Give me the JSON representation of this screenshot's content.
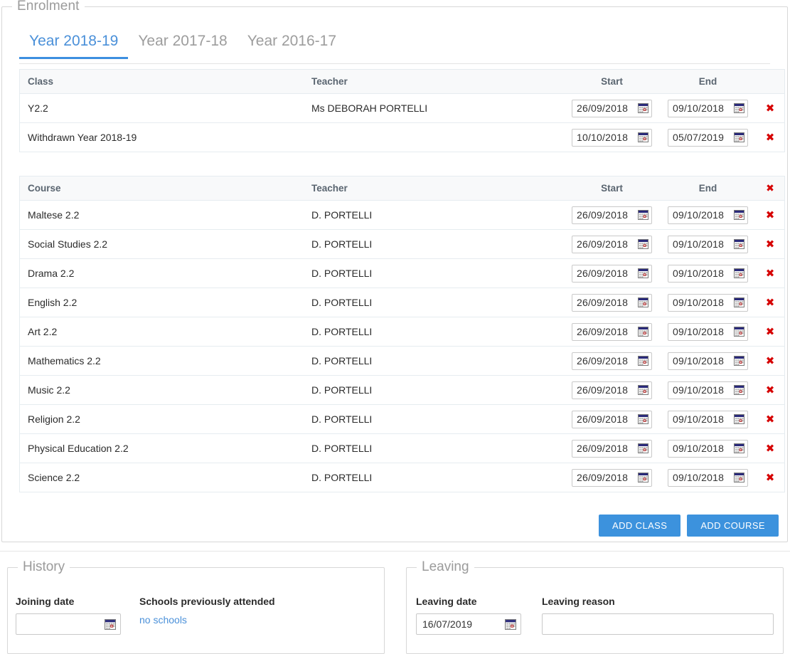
{
  "enrolment": {
    "legend": "Enrolment",
    "tabs": [
      {
        "label": "Year 2018-19",
        "active": true
      },
      {
        "label": "Year 2017-18",
        "active": false
      },
      {
        "label": "Year 2016-17",
        "active": false
      }
    ],
    "class_table": {
      "headers": {
        "name": "Class",
        "teacher": "Teacher",
        "start": "Start",
        "end": "End",
        "delete": ""
      },
      "rows": [
        {
          "name": "Y2.2",
          "teacher": "Ms DEBORAH PORTELLI",
          "start": "26/09/2018",
          "end": "09/10/2018",
          "delete": "✖"
        },
        {
          "name": "Withdrawn Year 2018-19",
          "teacher": "",
          "start": "10/10/2018",
          "end": "05/07/2019",
          "delete": "✖"
        }
      ]
    },
    "course_table": {
      "headers": {
        "name": "Course",
        "teacher": "Teacher",
        "start": "Start",
        "end": "End",
        "delete": "✖"
      },
      "rows": [
        {
          "name": "Maltese 2.2",
          "teacher": "D. PORTELLI",
          "start": "26/09/2018",
          "end": "09/10/2018",
          "delete": "✖"
        },
        {
          "name": "Social Studies 2.2",
          "teacher": "D. PORTELLI",
          "start": "26/09/2018",
          "end": "09/10/2018",
          "delete": "✖"
        },
        {
          "name": "Drama 2.2",
          "teacher": "D. PORTELLI",
          "start": "26/09/2018",
          "end": "09/10/2018",
          "delete": "✖"
        },
        {
          "name": "English 2.2",
          "teacher": "D. PORTELLI",
          "start": "26/09/2018",
          "end": "09/10/2018",
          "delete": "✖"
        },
        {
          "name": "Art 2.2",
          "teacher": "D. PORTELLI",
          "start": "26/09/2018",
          "end": "09/10/2018",
          "delete": "✖"
        },
        {
          "name": "Mathematics 2.2",
          "teacher": "D. PORTELLI",
          "start": "26/09/2018",
          "end": "09/10/2018",
          "delete": "✖"
        },
        {
          "name": "Music 2.2",
          "teacher": "D. PORTELLI",
          "start": "26/09/2018",
          "end": "09/10/2018",
          "delete": "✖"
        },
        {
          "name": "Religion 2.2",
          "teacher": "D. PORTELLI",
          "start": "26/09/2018",
          "end": "09/10/2018",
          "delete": "✖"
        },
        {
          "name": "Physical Education 2.2",
          "teacher": "D. PORTELLI",
          "start": "26/09/2018",
          "end": "09/10/2018",
          "delete": "✖"
        },
        {
          "name": "Science 2.2",
          "teacher": "D. PORTELLI",
          "start": "26/09/2018",
          "end": "09/10/2018",
          "delete": "✖"
        }
      ]
    },
    "buttons": {
      "add_class": "ADD CLASS",
      "add_course": "ADD COURSE"
    }
  },
  "history": {
    "legend": "History",
    "joining_date_label": "Joining date",
    "joining_date_value": "",
    "schools_label": "Schools previously attended",
    "schools_value": "no schools"
  },
  "leaving": {
    "legend": "Leaving",
    "leaving_date_label": "Leaving date",
    "leaving_date_value": "16/07/2019",
    "leaving_reason_label": "Leaving reason",
    "leaving_reason_value": ""
  },
  "icons": {
    "calendar": "calendar-icon",
    "delete": "delete-icon"
  },
  "colors": {
    "accent": "#3c92dd",
    "tab_active": "#4a90d9",
    "delete_red": "#d60000",
    "link": "#4a90d9",
    "legend_gray": "#9b9b9b",
    "header_bg": "#f8f9fa",
    "border": "#e6ecf0"
  }
}
